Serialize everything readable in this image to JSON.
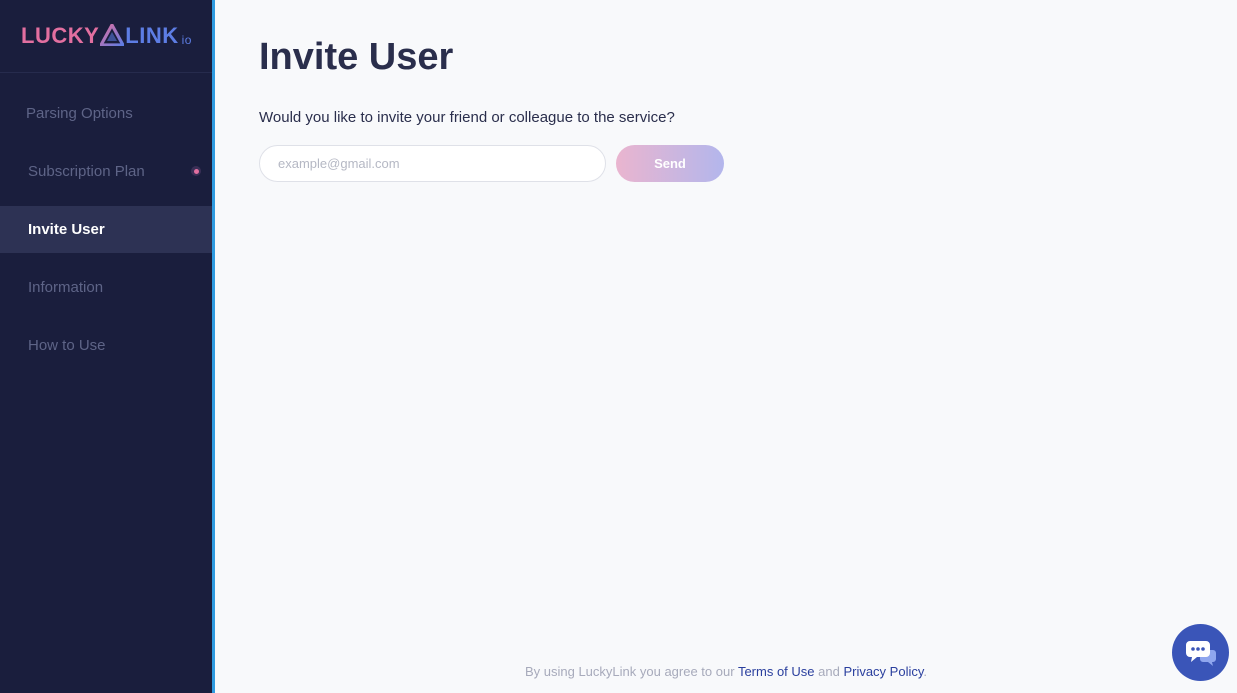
{
  "brand": {
    "part1": "LUCKY",
    "part2": "LINK",
    "suffix": "io",
    "colors": {
      "pink": "#e26fa0",
      "blue": "#5d7de4"
    }
  },
  "sidebar": {
    "items": [
      {
        "label": "Parsing Options",
        "active": false
      },
      {
        "label": "Subscription Plan",
        "active": false,
        "badge": true
      },
      {
        "label": "Invite User",
        "active": true
      },
      {
        "label": "Information",
        "active": false
      },
      {
        "label": "How to Use",
        "active": false
      }
    ]
  },
  "main": {
    "title": "Invite User",
    "subtitle": "Would you like to invite your friend or colleague to the service?",
    "email_placeholder": "example@gmail.com",
    "email_value": "",
    "send_label": "Send"
  },
  "footer": {
    "prefix": "By using LuckyLink you agree to our ",
    "terms": "Terms of Use",
    "and": " and ",
    "privacy": "Privacy Policy",
    "suffix": "."
  },
  "chat": {
    "icon": "chat-bubble-icon"
  },
  "colors": {
    "sidebar_bg": "#1a1e3d",
    "sidebar_active": "#2d3254",
    "accent_border": "#2f9be0",
    "text_dark": "#2a2e4c",
    "link": "#2a3f9e",
    "chat_bg": "#3a55b8"
  }
}
